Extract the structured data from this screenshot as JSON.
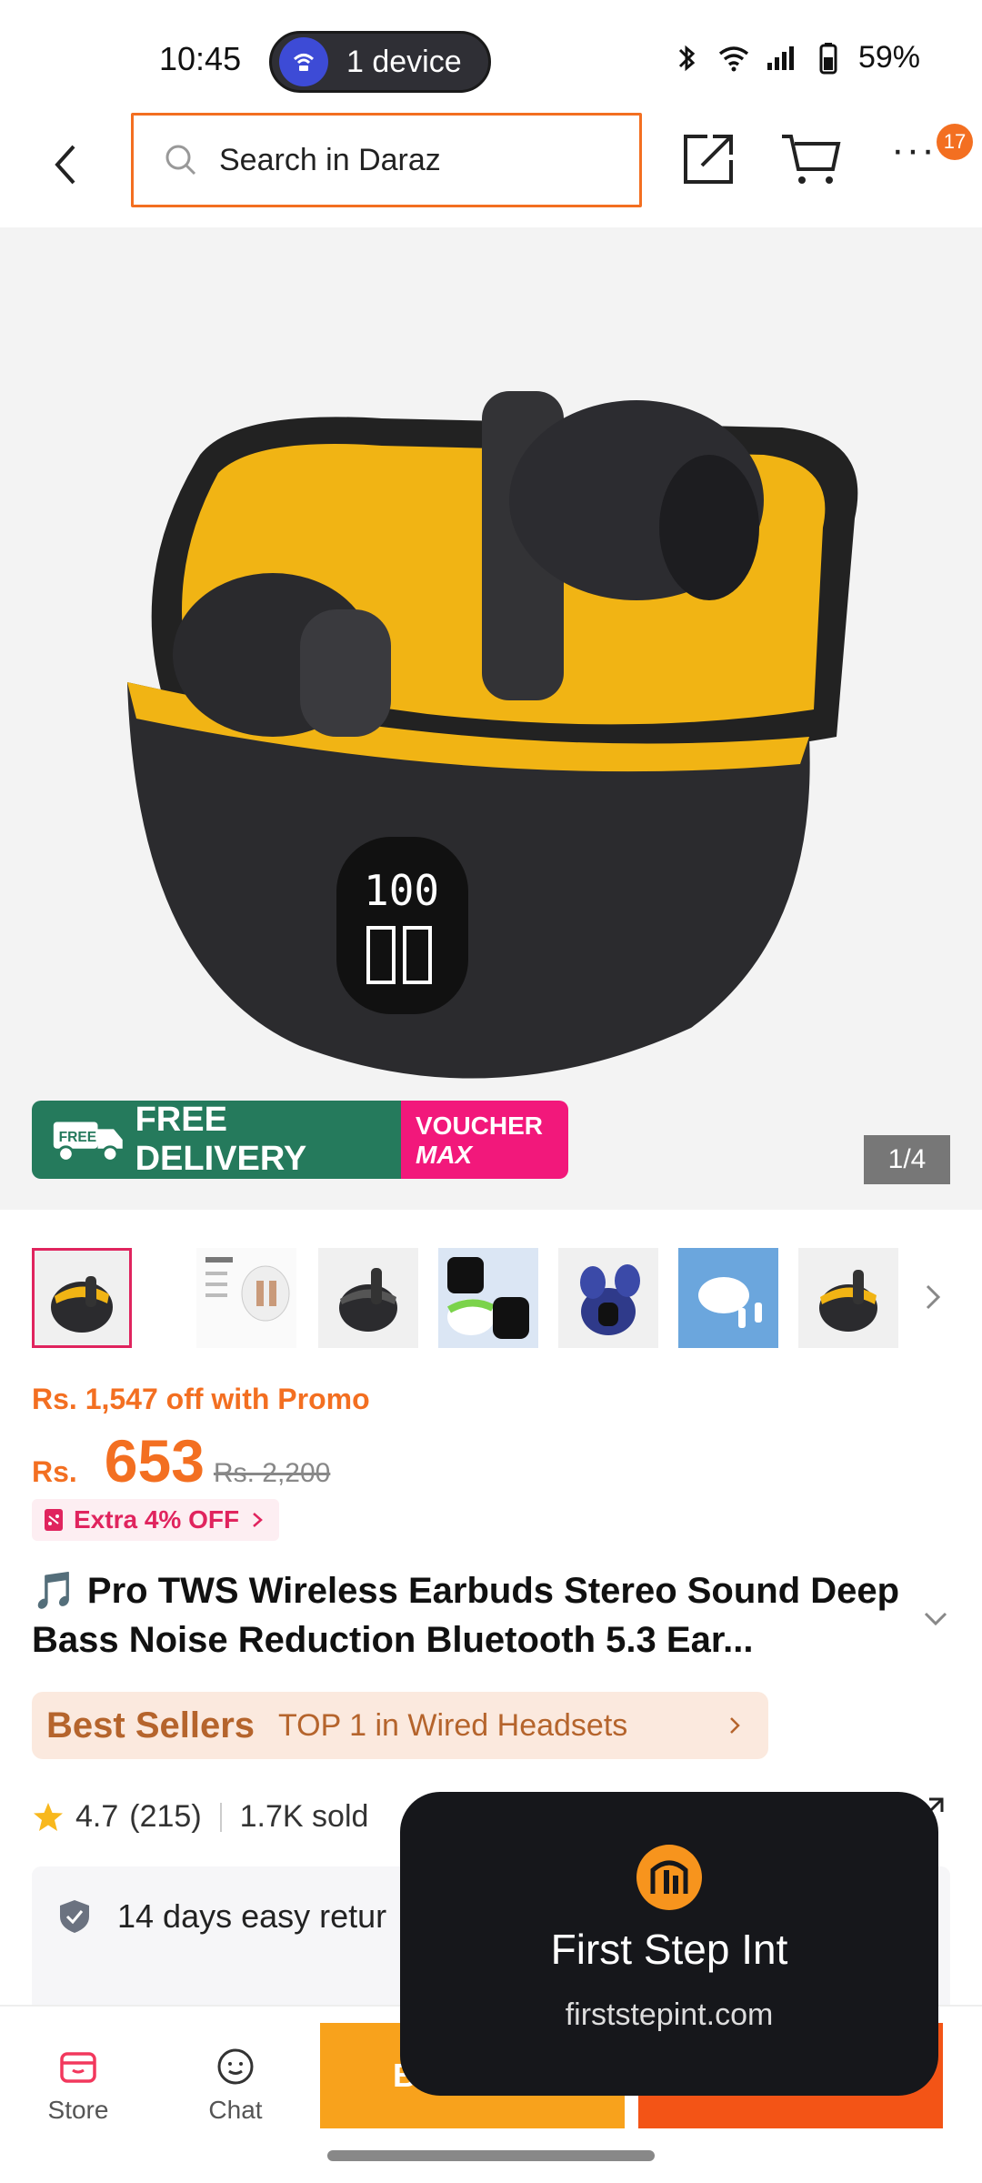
{
  "status_bar": {
    "time": "10:45",
    "device_label": "1 device",
    "battery": "59%"
  },
  "header": {
    "search_placeholder": "Search in Daraz",
    "cart_badge": "17"
  },
  "gallery": {
    "free_delivery": "FREE DELIVERY",
    "free_tag": "FREE",
    "voucher_line1": "VOUCHER",
    "voucher_line2": "MAX",
    "page_indicator": "1/4"
  },
  "price": {
    "promo_text": "Rs. 1,547 off with Promo",
    "currency": "Rs.",
    "current": "653",
    "original": "Rs. 2,200",
    "extra_off": "Extra 4% OFF"
  },
  "product": {
    "title": "🎵 Pro TWS Wireless Earbuds Stereo Sound Deep Bass Noise Reduction Bluetooth 5.3 Ear..."
  },
  "best_sellers": {
    "logo": "Best Sellers",
    "text": "TOP 1 in Wired Headsets"
  },
  "rating": {
    "score": "4.7",
    "count": "(215)",
    "sold": "1.7K sold"
  },
  "guarantee": {
    "returns": "14 days easy retur"
  },
  "bottom_bar": {
    "store_label": "Store",
    "chat_label": "Chat",
    "buy_label": "B"
  },
  "toast": {
    "name": "First Step Int",
    "url": "firststepint.com"
  },
  "colors": {
    "accent": "#f36f21",
    "pink": "#e0245e",
    "green": "#257a5c"
  }
}
